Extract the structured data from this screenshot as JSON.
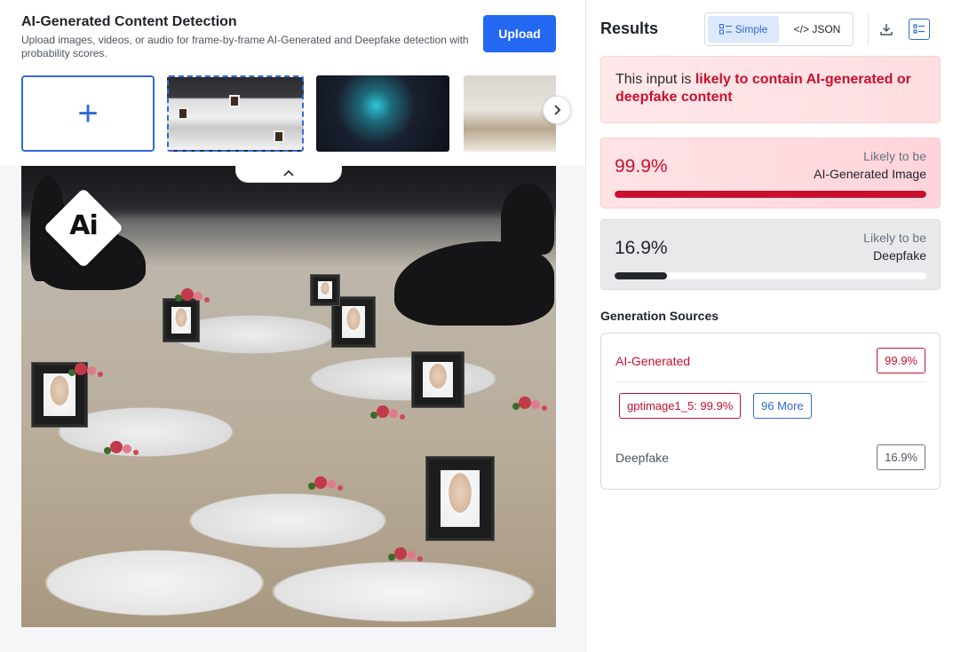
{
  "header": {
    "title": "AI-Generated Content Detection",
    "subtitle": "Upload images, videos, or audio for frame-by-frame AI-Generated and Deepfake detection with probability scores.",
    "upload_label": "Upload"
  },
  "thumbnails": {
    "add_icon": "plus-icon",
    "next_icon": "chevron-right-icon"
  },
  "preview": {
    "badge_text": "Ai",
    "collapse_icon": "chevron-up-icon"
  },
  "results": {
    "title": "Results",
    "view_simple_label": "Simple",
    "view_json_label": "</> JSON",
    "download_icon": "download-icon",
    "report_icon": "report-icon",
    "verdict_prefix": "This input is ",
    "verdict_highlight": "likely to contain AI-generated or deepfake content",
    "scores": [
      {
        "value_text": "99.9%",
        "value": 99.9,
        "line1": "Likely to be",
        "line2": "AI-Generated Image"
      },
      {
        "value_text": "16.9%",
        "value": 16.9,
        "line1": "Likely to be",
        "line2": "Deepfake"
      }
    ],
    "generation_sources": {
      "title": "Generation Sources",
      "ai_label": "AI-Generated",
      "ai_value": "99.9%",
      "model_tag": "gptimage1_5: 99.9%",
      "more_tag": "96 More",
      "deepfake_label": "Deepfake",
      "deepfake_value": "16.9%"
    }
  },
  "colors": {
    "accent": "#2468f2",
    "danger": "#c8102e",
    "dark_bar": "#25272b"
  }
}
